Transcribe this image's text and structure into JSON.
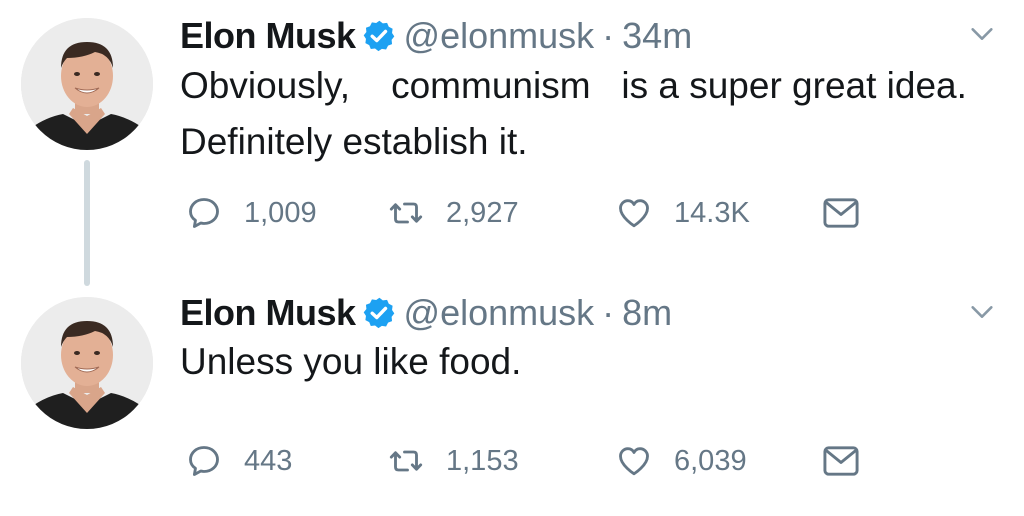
{
  "tweets": [
    {
      "author_name": "Elon Musk",
      "handle": "@elonmusk",
      "separator": "·",
      "time": "34m",
      "text": "Obviously,    communism   is a super great idea. Definitely establish it.",
      "replies": "1,009",
      "retweets": "2,927",
      "likes": "14.3K"
    },
    {
      "author_name": "Elon Musk",
      "handle": "@elonmusk",
      "separator": "·",
      "time": "8m",
      "text": "Unless you like food.",
      "replies": "443",
      "retweets": "1,153",
      "likes": "6,039"
    }
  ],
  "icons": {
    "verified": "verified-badge-icon",
    "caret": "chevron-down-icon",
    "reply": "reply-bubble-icon",
    "retweet": "retweet-icon",
    "like": "heart-icon",
    "dm": "envelope-icon"
  },
  "colors": {
    "verified_blue": "#1da1f2",
    "secondary_text": "#657786",
    "thread_line": "#cfd9de"
  }
}
